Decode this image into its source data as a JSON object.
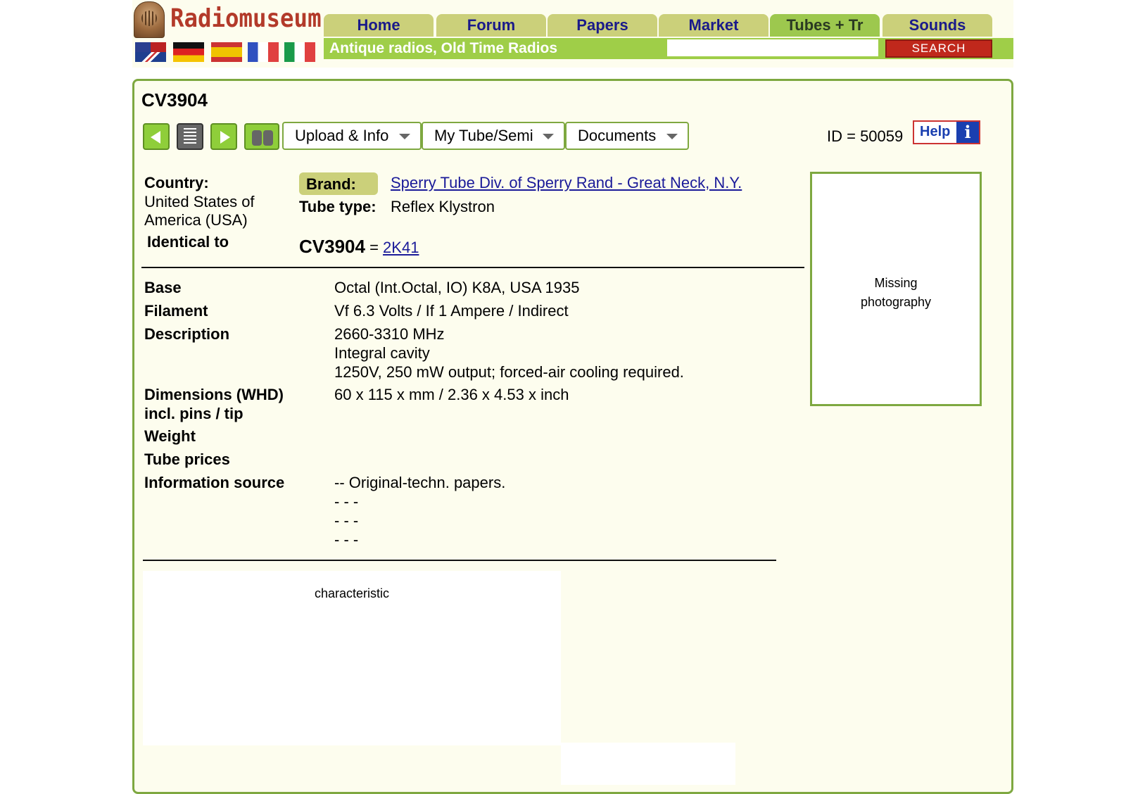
{
  "header": {
    "logo_text": "Radiomuseum",
    "nav": [
      "Home",
      "Forum",
      "Papers",
      "Market",
      "Tubes + Tr",
      "Sounds"
    ],
    "active_nav": "Tubes + Tr",
    "tagline": "Antique radios, Old Time Radios",
    "search_value": "",
    "search_button": "SEARCH",
    "flags": [
      "us-uk-flag-icon",
      "germany-flag-icon",
      "spain-flag-icon",
      "france-flag-icon",
      "italy-flag-icon"
    ]
  },
  "page": {
    "title": "CV3904",
    "toolbar": {
      "upload_info": "Upload & Info",
      "my_tube": "My Tube/Semi",
      "documents": "Documents",
      "id_text": "ID = 50059",
      "help": "Help",
      "info_glyph": "i"
    },
    "country_label": "Country:",
    "country_value": "United States of America (USA)",
    "identical_label": "Identical to",
    "brand_label": "Brand:",
    "brand_value": "Sperry Tube Div. of Sperry Rand - Great Neck, N.Y.",
    "tubetype_label": "Tube type:",
    "tubetype_value": "Reflex Klystron",
    "ident_name": "CV3904",
    "ident_eq": " = ",
    "ident_link": "2K41",
    "photo_text_1": "Missing",
    "photo_text_2": "photography",
    "specs": {
      "base_label": "Base",
      "base_value": "Octal (Int.Octal, IO) K8A, USA 1935",
      "filament_label": "Filament",
      "filament_value": "Vf 6.3 Volts / If 1 Ampere / Indirect",
      "description_label": "Description",
      "description_lines": [
        "2660-3310 MHz",
        "Integral cavity",
        "1250V, 250 mW output; forced-air cooling required."
      ],
      "dimensions_label_1": "Dimensions (WHD)",
      "dimensions_label_2": "incl. pins / tip",
      "dimensions_value": "60 x 115 x mm / 2.36 x 4.53 x inch",
      "weight_label": "Weight",
      "prices_label": "Tube prices",
      "source_label": "Information source",
      "source_lines": [
        "-- Original-techn. papers.",
        "- - -",
        "- - -",
        "- - -"
      ]
    },
    "characteristic": "characteristic"
  },
  "colors": {
    "accent_green": "#7ea840",
    "nav_tab": "#cbd07a",
    "nav_active": "#9dc84e",
    "tagline_bar": "#9fce48",
    "search_red": "#c0281c",
    "panel_bg": "#fdfdee",
    "link": "#1a1a99"
  }
}
